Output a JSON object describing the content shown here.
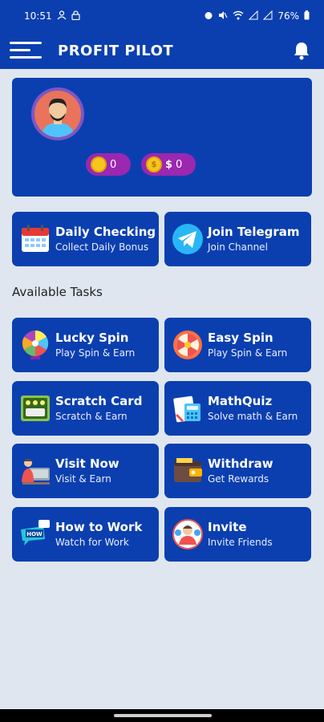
{
  "status": {
    "time": "10:51",
    "battery": "76%"
  },
  "app": {
    "title": "PROFIT PILOT"
  },
  "profile": {
    "coins": "0",
    "money_symbol": "$",
    "money": "0",
    "avatar_bg": "#e9735b"
  },
  "top_tiles": [
    {
      "title": "Daily Checking",
      "subtitle": "Collect Daily Bonus",
      "icon": "calendar-icon"
    },
    {
      "title": "Join Telegram",
      "subtitle": "Join Channel",
      "icon": "telegram-icon"
    }
  ],
  "section": {
    "available_tasks": "Available Tasks"
  },
  "tasks": [
    {
      "title": "Lucky Spin",
      "subtitle": "Play Spin & Earn",
      "icon": "lucky-wheel-icon"
    },
    {
      "title": "Easy Spin",
      "subtitle": "Play Spin & Earn",
      "icon": "easy-wheel-icon"
    },
    {
      "title": "Scratch Card",
      "subtitle": "Scratch & Earn",
      "icon": "scratch-card-icon"
    },
    {
      "title": "MathQuiz",
      "subtitle": "Solve math & Earn",
      "icon": "math-quiz-icon"
    },
    {
      "title": "Visit Now",
      "subtitle": "Visit & Earn",
      "icon": "visit-icon"
    },
    {
      "title": "Withdraw",
      "subtitle": "Get Rewards",
      "icon": "wallet-icon"
    },
    {
      "title": "How to Work",
      "subtitle": "Watch for Work",
      "icon": "how-icon"
    },
    {
      "title": "Invite",
      "subtitle": "Invite Friends",
      "icon": "invite-icon"
    }
  ],
  "colors": {
    "primary": "#0b3fb0",
    "background": "#dfe6ef",
    "pill": "#9c27b0",
    "coin": "#f7c51e"
  }
}
